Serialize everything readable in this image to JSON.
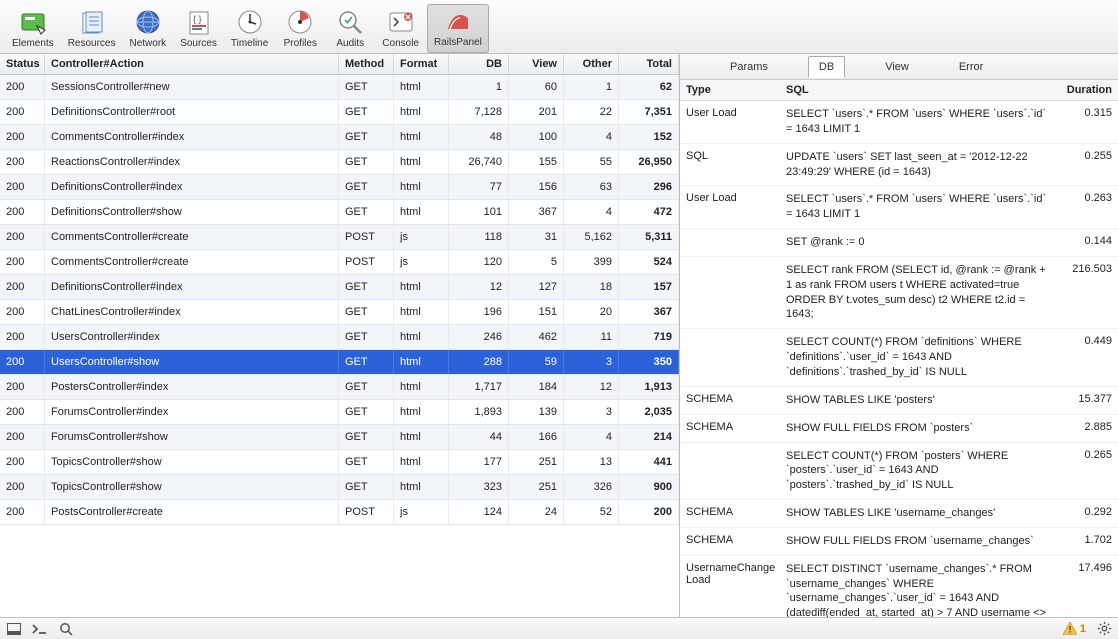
{
  "toolbar": {
    "items": [
      {
        "id": "elements",
        "label": "Elements"
      },
      {
        "id": "resources",
        "label": "Resources"
      },
      {
        "id": "network",
        "label": "Network"
      },
      {
        "id": "sources",
        "label": "Sources"
      },
      {
        "id": "timeline",
        "label": "Timeline"
      },
      {
        "id": "profiles",
        "label": "Profiles"
      },
      {
        "id": "audits",
        "label": "Audits"
      },
      {
        "id": "console",
        "label": "Console"
      },
      {
        "id": "railspanel",
        "label": "RailsPanel"
      }
    ],
    "selected": "railspanel"
  },
  "requests": {
    "columns": {
      "status": "Status",
      "action": "Controller#Action",
      "method": "Method",
      "format": "Format",
      "db": "DB",
      "view": "View",
      "other": "Other",
      "total": "Total"
    },
    "selectedIndex": 13,
    "rows": [
      {
        "status": "200",
        "action": "SessionsController#new",
        "method": "GET",
        "format": "html",
        "db": "1",
        "view": "60",
        "other": "1",
        "total": "62"
      },
      {
        "status": "200",
        "action": "DefinitionsController#root",
        "method": "GET",
        "format": "html",
        "db": "7,128",
        "view": "201",
        "other": "22",
        "total": "7,351"
      },
      {
        "status": "200",
        "action": "CommentsController#index",
        "method": "GET",
        "format": "html",
        "db": "48",
        "view": "100",
        "other": "4",
        "total": "152"
      },
      {
        "status": "200",
        "action": "ReactionsController#index",
        "method": "GET",
        "format": "html",
        "db": "26,740",
        "view": "155",
        "other": "55",
        "total": "26,950"
      },
      {
        "status": "200",
        "action": "DefinitionsController#index",
        "method": "GET",
        "format": "html",
        "db": "77",
        "view": "156",
        "other": "63",
        "total": "296"
      },
      {
        "status": "200",
        "action": "DefinitionsController#show",
        "method": "GET",
        "format": "html",
        "db": "101",
        "view": "367",
        "other": "4",
        "total": "472"
      },
      {
        "status": "200",
        "action": "CommentsController#create",
        "method": "POST",
        "format": "js",
        "db": "118",
        "view": "31",
        "other": "5,162",
        "total": "5,311"
      },
      {
        "status": "200",
        "action": "CommentsController#create",
        "method": "POST",
        "format": "js",
        "db": "120",
        "view": "5",
        "other": "399",
        "total": "524"
      },
      {
        "status": "200",
        "action": "DefinitionsController#index",
        "method": "GET",
        "format": "html",
        "db": "12",
        "view": "127",
        "other": "18",
        "total": "157"
      },
      {
        "status": "200",
        "action": "ChatLinesController#index",
        "method": "GET",
        "format": "html",
        "db": "196",
        "view": "151",
        "other": "20",
        "total": "367"
      },
      {
        "status": "200",
        "action": "UsersController#index",
        "method": "GET",
        "format": "html",
        "db": "246",
        "view": "462",
        "other": "11",
        "total": "719"
      },
      {
        "status": "200",
        "action": "UsersController#show",
        "method": "GET",
        "format": "html",
        "db": "288",
        "view": "59",
        "other": "3",
        "total": "350"
      },
      {
        "status": "200",
        "action": "PostersController#index",
        "method": "GET",
        "format": "html",
        "db": "1,717",
        "view": "184",
        "other": "12",
        "total": "1,913"
      },
      {
        "status": "200",
        "action": "ForumsController#index",
        "method": "GET",
        "format": "html",
        "db": "1,893",
        "view": "139",
        "other": "3",
        "total": "2,035"
      },
      {
        "status": "200",
        "action": "ForumsController#show",
        "method": "GET",
        "format": "html",
        "db": "44",
        "view": "166",
        "other": "4",
        "total": "214"
      },
      {
        "status": "200",
        "action": "TopicsController#show",
        "method": "GET",
        "format": "html",
        "db": "177",
        "view": "251",
        "other": "13",
        "total": "441"
      },
      {
        "status": "200",
        "action": "TopicsController#show",
        "method": "GET",
        "format": "html",
        "db": "323",
        "view": "251",
        "other": "326",
        "total": "900"
      },
      {
        "status": "200",
        "action": "PostsController#create",
        "method": "POST",
        "format": "js",
        "db": "124",
        "view": "24",
        "other": "52",
        "total": "200"
      }
    ]
  },
  "detailTabs": {
    "items": [
      {
        "id": "params",
        "label": "Params"
      },
      {
        "id": "db",
        "label": "DB"
      },
      {
        "id": "view",
        "label": "View"
      },
      {
        "id": "error",
        "label": "Error"
      }
    ],
    "active": "db"
  },
  "sql": {
    "columns": {
      "type": "Type",
      "sql": "SQL",
      "duration": "Duration"
    },
    "rows": [
      {
        "type": "User Load",
        "sql": "SELECT `users`.* FROM `users` WHERE `users`.`id` = 1643 LIMIT 1",
        "duration": "0.315"
      },
      {
        "type": "SQL",
        "sql": "UPDATE `users` SET last_seen_at = '2012-12-22 23:49:29' WHERE (id = 1643)",
        "duration": "0.255"
      },
      {
        "type": "User Load",
        "sql": "SELECT `users`.* FROM `users` WHERE `users`.`id` = 1643 LIMIT 1",
        "duration": "0.263"
      },
      {
        "type": "",
        "sql": "SET @rank := 0",
        "duration": "0.144"
      },
      {
        "type": "",
        "sql": "SELECT rank FROM (SELECT id, @rank := @rank + 1 as rank FROM users t WHERE activated=true ORDER BY t.votes_sum desc) t2 WHERE t2.id = 1643;",
        "duration": "216.503"
      },
      {
        "type": "",
        "sql": "SELECT COUNT(*) FROM `definitions` WHERE `definitions`.`user_id` = 1643 AND `definitions`.`trashed_by_id` IS NULL",
        "duration": "0.449"
      },
      {
        "type": "SCHEMA",
        "sql": "SHOW TABLES LIKE 'posters'",
        "duration": "15.377"
      },
      {
        "type": "SCHEMA",
        "sql": "SHOW FULL FIELDS FROM `posters`",
        "duration": "2.885"
      },
      {
        "type": "",
        "sql": "SELECT COUNT(*) FROM `posters` WHERE `posters`.`user_id` = 1643 AND `posters`.`trashed_by_id` IS NULL",
        "duration": "0.265"
      },
      {
        "type": "SCHEMA",
        "sql": "SHOW TABLES LIKE 'username_changes'",
        "duration": "0.292"
      },
      {
        "type": "SCHEMA",
        "sql": "SHOW FULL FIELDS FROM `username_changes`",
        "duration": "1.702"
      },
      {
        "type": "UsernameChange Load",
        "sql": "SELECT DISTINCT `username_changes`.* FROM `username_changes` WHERE `username_changes`.`user_id` = 1643 AND (datediff(ended_at, started_at) > 7 AND username <> 'rompier')",
        "duration": "17.496"
      }
    ]
  },
  "statusbar": {
    "warnings": "1"
  }
}
